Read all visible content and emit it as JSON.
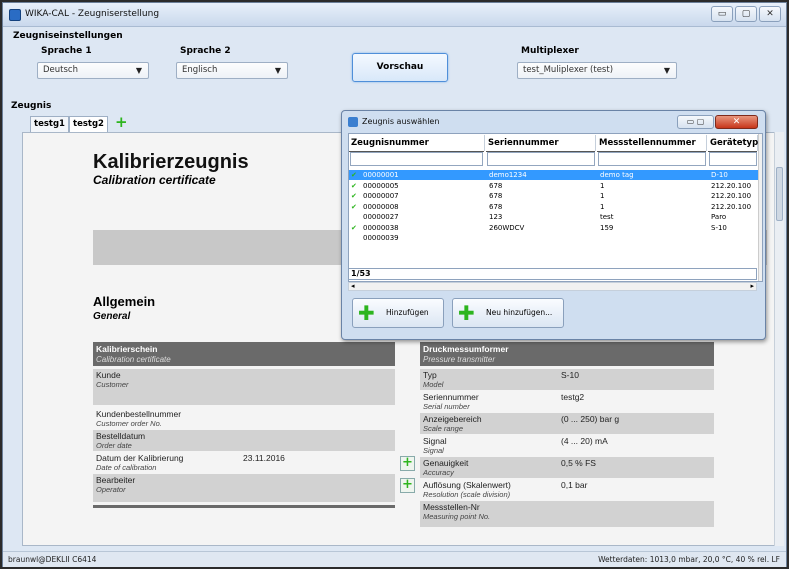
{
  "window": {
    "title": "WIKA-CAL - Zeugniserstellung",
    "buttons": [
      "▭",
      "▢",
      "✕"
    ]
  },
  "settings": {
    "label": "Zeugniseinstellungen",
    "lang1_label": "Sprache 1",
    "lang1_value": "Deutsch",
    "lang2_label": "Sprache 2",
    "lang2_value": "Englisch",
    "preview_button": "Vorschau",
    "mux_label": "Multiplexer",
    "mux_value": "test_Muliplexer (test)"
  },
  "zeugnis": {
    "label": "Zeugnis",
    "tabs": [
      "testg1",
      "testg2"
    ],
    "add_tab": "+"
  },
  "document": {
    "title": "Kalibrierzeugnis",
    "title_en": "Calibration certificate",
    "section": "Allgemein",
    "section_en": "General",
    "left_header": {
      "de": "Kalibrierschein",
      "en": "Calibration certificate"
    },
    "left_rows": [
      {
        "de": "Kunde",
        "en": "Customer",
        "value": ""
      },
      {
        "de": "Kundenbestellnummer",
        "en": "Customer order No.",
        "value": ""
      },
      {
        "de": "Bestelldatum",
        "en": "Order date",
        "value": ""
      },
      {
        "de": "Datum der Kalibrierung",
        "en": "Date of calibration",
        "value": "23.11.2016"
      },
      {
        "de": "Bearbeiter",
        "en": "Operator",
        "value": ""
      }
    ],
    "right_header": {
      "de": "Druckmessumformer",
      "en": "Pressure transmitter"
    },
    "right_rows": [
      {
        "de": "Typ",
        "en": "Model",
        "value": "S-10"
      },
      {
        "de": "Seriennummer",
        "en": "Serial number",
        "value": "testg2"
      },
      {
        "de": "Anzeigebereich",
        "en": "Scale range",
        "value": "(0 ... 250) bar g"
      },
      {
        "de": "Signal",
        "en": "Signal",
        "value": "(4 ... 20) mA"
      },
      {
        "de": "Genauigkeit",
        "en": "Accuracy",
        "value": "0,5 % FS"
      },
      {
        "de": "Auflösung (Skalenwert)",
        "en": "Resolution (scale division)",
        "value": "0,1 bar"
      },
      {
        "de": "Messstellen-Nr",
        "en": "Measuring point No.",
        "value": ""
      }
    ]
  },
  "dialog": {
    "title": "Zeugnis auswählen",
    "columns": [
      "Zeugnisnummer",
      "Seriennummer",
      "Messstellennummer",
      "Gerätetyp"
    ],
    "rows": [
      {
        "check": true,
        "id": "00000001",
        "serial": "demo1234",
        "point": "demo tag",
        "type": "D-10",
        "selected": true
      },
      {
        "check": true,
        "id": "00000005",
        "serial": "678",
        "point": "1",
        "type": "212.20.100",
        "selected": false
      },
      {
        "check": true,
        "id": "00000007",
        "serial": "678",
        "point": "1",
        "type": "212.20.100",
        "selected": false
      },
      {
        "check": true,
        "id": "00000008",
        "serial": "678",
        "point": "1",
        "type": "212.20.100",
        "selected": false
      },
      {
        "check": false,
        "id": "00000027",
        "serial": "123",
        "point": "test",
        "type": "Paro",
        "selected": false
      },
      {
        "check": true,
        "id": "00000038",
        "serial": "260WDCV",
        "point": "159",
        "type": "S-10",
        "selected": false
      },
      {
        "check": false,
        "id": "00000039",
        "serial": "",
        "point": "",
        "type": "",
        "selected": false
      }
    ],
    "pager": "1/53",
    "add_button": "Hinzufügen",
    "new_button": "Neu hinzufügen...",
    "check_glyph": "✔"
  },
  "status": {
    "left": "braunwl@DEKLII C6414",
    "right": "Wetterdaten: 1013,0 mbar, 20,0 °C, 40 % rel. LF"
  },
  "colors": {
    "accent": "#3399ff",
    "plus": "#2db51e",
    "header_dark": "#6a6a6a"
  }
}
